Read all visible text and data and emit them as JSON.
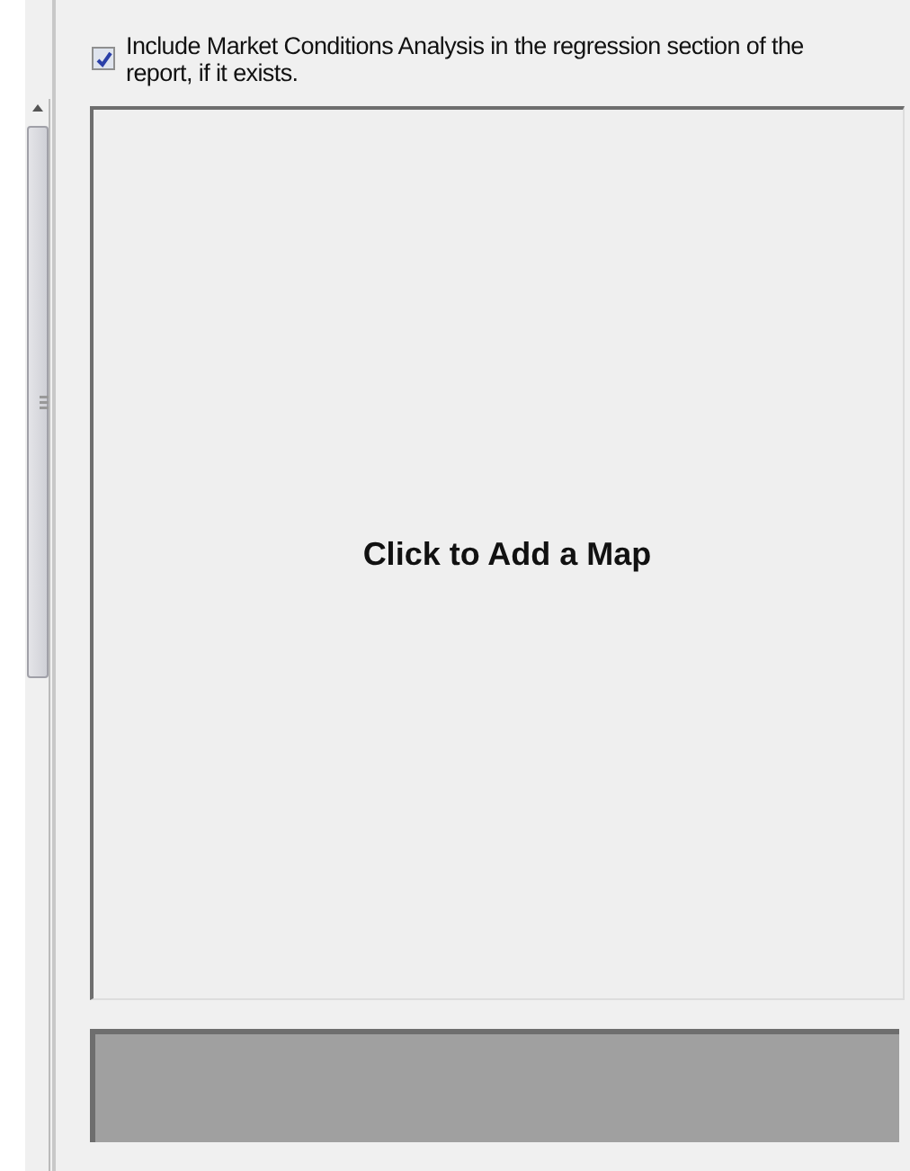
{
  "market_conditions_option": {
    "label": "Include Market Conditions Analysis in the regression section of the report, if it exists.",
    "checked": true
  },
  "map_panel": {
    "prompt": "Click to Add a Map"
  }
}
